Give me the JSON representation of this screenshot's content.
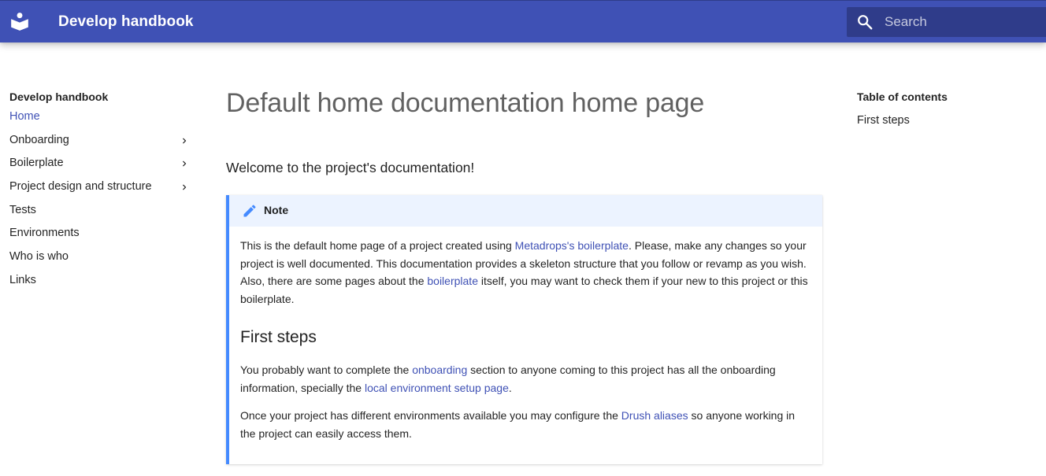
{
  "header": {
    "title": "Develop handbook",
    "search_placeholder": "Search",
    "logo_icon": "book-reader-icon",
    "bg_color": "#3f51b5"
  },
  "sidebar": {
    "title": "Develop handbook",
    "items": [
      {
        "label": "Home",
        "active": true,
        "expandable": false
      },
      {
        "label": "Onboarding",
        "active": false,
        "expandable": true
      },
      {
        "label": "Boilerplate",
        "active": false,
        "expandable": true
      },
      {
        "label": "Project design and structure",
        "active": false,
        "expandable": true
      },
      {
        "label": "Tests",
        "active": false,
        "expandable": false
      },
      {
        "label": "Environments",
        "active": false,
        "expandable": false
      },
      {
        "label": "Who is who",
        "active": false,
        "expandable": false
      },
      {
        "label": "Links",
        "active": false,
        "expandable": false
      }
    ]
  },
  "toc": {
    "title": "Table of contents",
    "items": [
      {
        "label": "First steps"
      }
    ]
  },
  "main": {
    "title": "Default home documentation home page",
    "intro": "Welcome to the project's documentation!",
    "note": {
      "title": "Note",
      "icon": "pencil-icon",
      "accent_color": "#448aff",
      "p1_a": "This is the default home page of a project created using ",
      "p1_link1": "Metadrops's boilerplate",
      "p1_b": ". Please, make any changes so your project is well documented. This documentation provides a skeleton structure that you follow or revamp as you wish. Also, there are some pages about the ",
      "p1_link2": "boilerplate",
      "p1_c": " itself, you may want to check them if your new to this project or this boilerplate.",
      "heading": "First steps",
      "p2_a": "You probably want to complete the ",
      "p2_link1": "onboarding",
      "p2_b": " section to anyone coming to this project has all the onboarding information, specially the ",
      "p2_link2": "local environment setup page",
      "p2_c": ".",
      "p3_a": "Once your project has different environments available you may configure the ",
      "p3_link1": "Drush aliases",
      "p3_b": " so anyone working in the project can easily access them."
    }
  }
}
